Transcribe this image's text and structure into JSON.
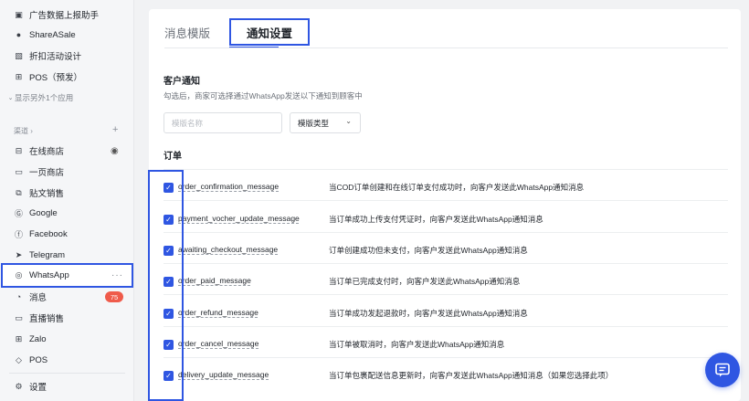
{
  "sidebar": {
    "apps": [
      {
        "icon": "image-icon",
        "label": "广告数据上报助手"
      },
      {
        "icon": "shareasale-icon",
        "label": "ShareASale"
      },
      {
        "icon": "discount-icon",
        "label": "折扣活动设计"
      },
      {
        "icon": "grid-icon",
        "label": "POS（预发）"
      }
    ],
    "show_more": "显示另外1个应用",
    "channels_label": "渠道",
    "channels": [
      {
        "icon": "store-icon",
        "label": "在线商店"
      },
      {
        "icon": "page-icon",
        "label": "一页商店"
      },
      {
        "icon": "post-icon",
        "label": "贴文销售"
      },
      {
        "icon": "google-icon",
        "label": "Google"
      },
      {
        "icon": "facebook-icon",
        "label": "Facebook"
      },
      {
        "icon": "telegram-icon",
        "label": "Telegram"
      },
      {
        "icon": "whatsapp-icon",
        "label": "WhatsApp"
      },
      {
        "icon": "message-icon",
        "label": "消息",
        "badge": "75"
      },
      {
        "icon": "live-icon",
        "label": "直播销售"
      },
      {
        "icon": "zalo-icon",
        "label": "Zalo"
      },
      {
        "icon": "pos-icon",
        "label": "POS"
      }
    ],
    "settings_label": "设置"
  },
  "tabs": {
    "templates": "消息模版",
    "notifications": "通知设置"
  },
  "customer_notice": {
    "title": "客户通知",
    "description": "勾选后，商家可选择通过WhatsApp发送以下通知到顾客中"
  },
  "filters": {
    "name_placeholder": "模版名称",
    "type_label": "模版类型"
  },
  "orders": {
    "title": "订单",
    "rows": [
      {
        "key": "order_confirmation_message",
        "checked": true,
        "description": "当COD订单创建和在线订单支付成功时，向客户发送此WhatsApp通知消息"
      },
      {
        "key": "payment_vocher_update_message",
        "checked": true,
        "description": "当订单成功上传支付凭证时，向客户发送此WhatsApp通知消息"
      },
      {
        "key": "awaiting_checkout_message",
        "checked": true,
        "description": "订单创建成功但未支付，向客户发送此WhatsApp通知消息"
      },
      {
        "key": "order_paid_message",
        "checked": true,
        "description": "当订单已完成支付时，向客户发送此WhatsApp通知消息"
      },
      {
        "key": "order_refund_message",
        "checked": true,
        "description": "当订单成功发起退款时，向客户发送此WhatsApp通知消息"
      },
      {
        "key": "order_cancel_message",
        "checked": true,
        "description": "当订单被取消时，向客户发送此WhatsApp通知消息"
      },
      {
        "key": "delivery_update_message",
        "checked": true,
        "description": "当订单包裹配送信息更新时，向客户发送此WhatsApp通知消息（如果您选择此项）"
      }
    ]
  },
  "colors": {
    "accent": "#2f56e2",
    "badge": "#ef5b4b"
  }
}
